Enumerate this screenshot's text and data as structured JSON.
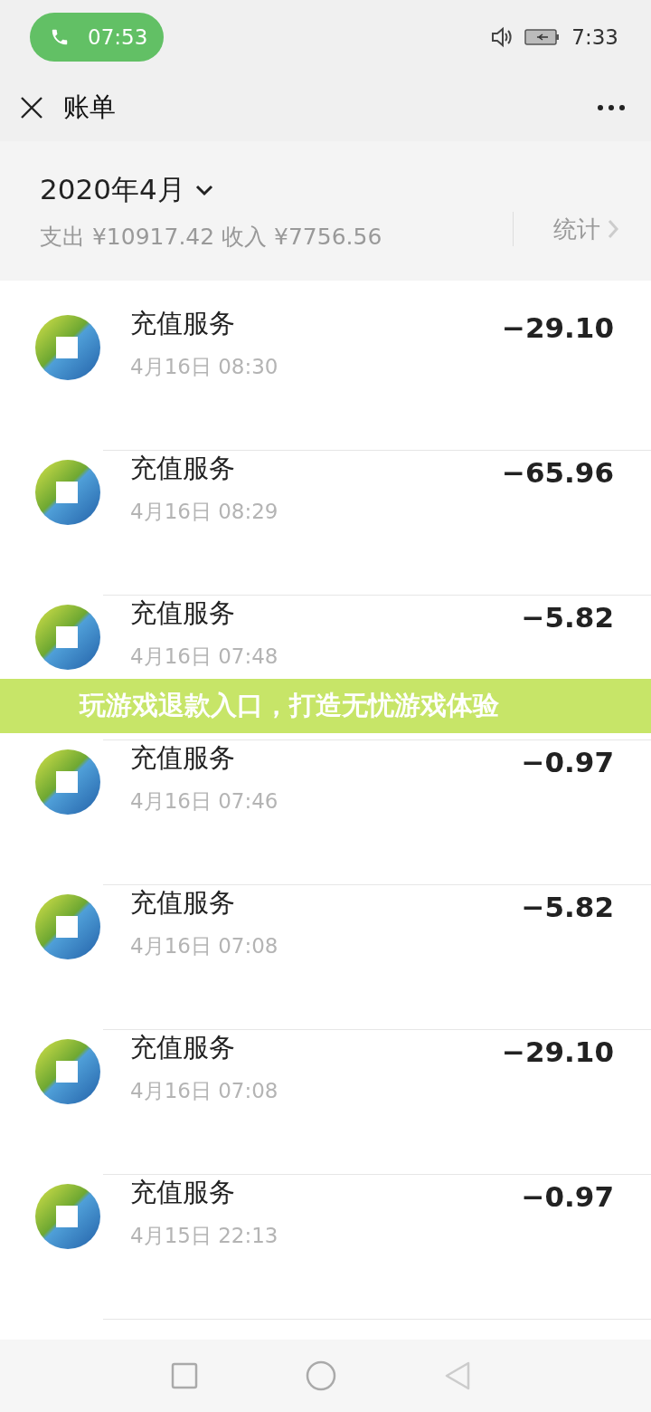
{
  "status_bar": {
    "call_time": "07:53",
    "time": "7:33"
  },
  "title_bar": {
    "title": "账单"
  },
  "summary": {
    "month": "2020年4月",
    "totals": "支出 ¥10917.42 收入 ¥7756.56",
    "stats_link": "统计"
  },
  "transactions": [
    {
      "title": "充值服务",
      "date": "4月16日 08:30",
      "amount": "−29.10"
    },
    {
      "title": "充值服务",
      "date": "4月16日 08:29",
      "amount": "−65.96"
    },
    {
      "title": "充值服务",
      "date": "4月16日 07:48",
      "amount": "−5.82"
    },
    {
      "title": "充值服务",
      "date": "4月16日 07:46",
      "amount": "−0.97"
    },
    {
      "title": "充值服务",
      "date": "4月16日 07:08",
      "amount": "−5.82"
    },
    {
      "title": "充值服务",
      "date": "4月16日 07:08",
      "amount": "−29.10"
    },
    {
      "title": "充值服务",
      "date": "4月15日 22:13",
      "amount": "−0.97"
    }
  ],
  "overlay_banner": {
    "text": "玩游戏退款入口，打造无忧游戏体验"
  }
}
